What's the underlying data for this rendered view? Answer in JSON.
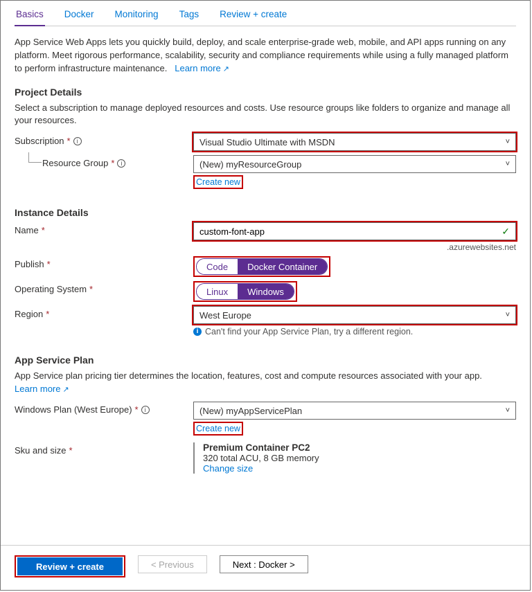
{
  "tabs": {
    "basics": "Basics",
    "docker": "Docker",
    "monitoring": "Monitoring",
    "tags": "Tags",
    "review": "Review + create"
  },
  "intro": "App Service Web Apps lets you quickly build, deploy, and scale enterprise-grade web, mobile, and API apps running on any platform. Meet rigorous performance, scalability, security and compliance requirements while using a fully managed platform to perform infrastructure maintenance.",
  "learn_more": "Learn more",
  "project": {
    "heading": "Project Details",
    "desc": "Select a subscription to manage deployed resources and costs. Use resource groups like folders to organize and manage all your resources.",
    "subscription_label": "Subscription",
    "subscription_value": "Visual Studio Ultimate with MSDN",
    "rg_label": "Resource Group",
    "rg_value": "(New) myResourceGroup",
    "create_new": "Create new"
  },
  "instance": {
    "heading": "Instance Details",
    "name_label": "Name",
    "name_value": "custom-font-app",
    "name_suffix": ".azurewebsites.net",
    "publish_label": "Publish",
    "publish_code": "Code",
    "publish_docker": "Docker Container",
    "os_label": "Operating System",
    "os_linux": "Linux",
    "os_windows": "Windows",
    "region_label": "Region",
    "region_value": "West Europe",
    "region_hint": "Can't find your App Service Plan, try a different region."
  },
  "plan": {
    "heading": "App Service Plan",
    "desc": "App Service plan pricing tier determines the location, features, cost and compute resources associated with your app.",
    "learn_more": "Learn more",
    "plan_label": "Windows Plan (West Europe)",
    "plan_value": "(New) myAppServicePlan",
    "create_new": "Create new",
    "sku_label": "Sku and size",
    "sku_name": "Premium Container PC2",
    "sku_detail": "320 total ACU, 8 GB memory",
    "change_size": "Change size"
  },
  "footer": {
    "review": "Review + create",
    "prev": "< Previous",
    "next": "Next : Docker >"
  }
}
